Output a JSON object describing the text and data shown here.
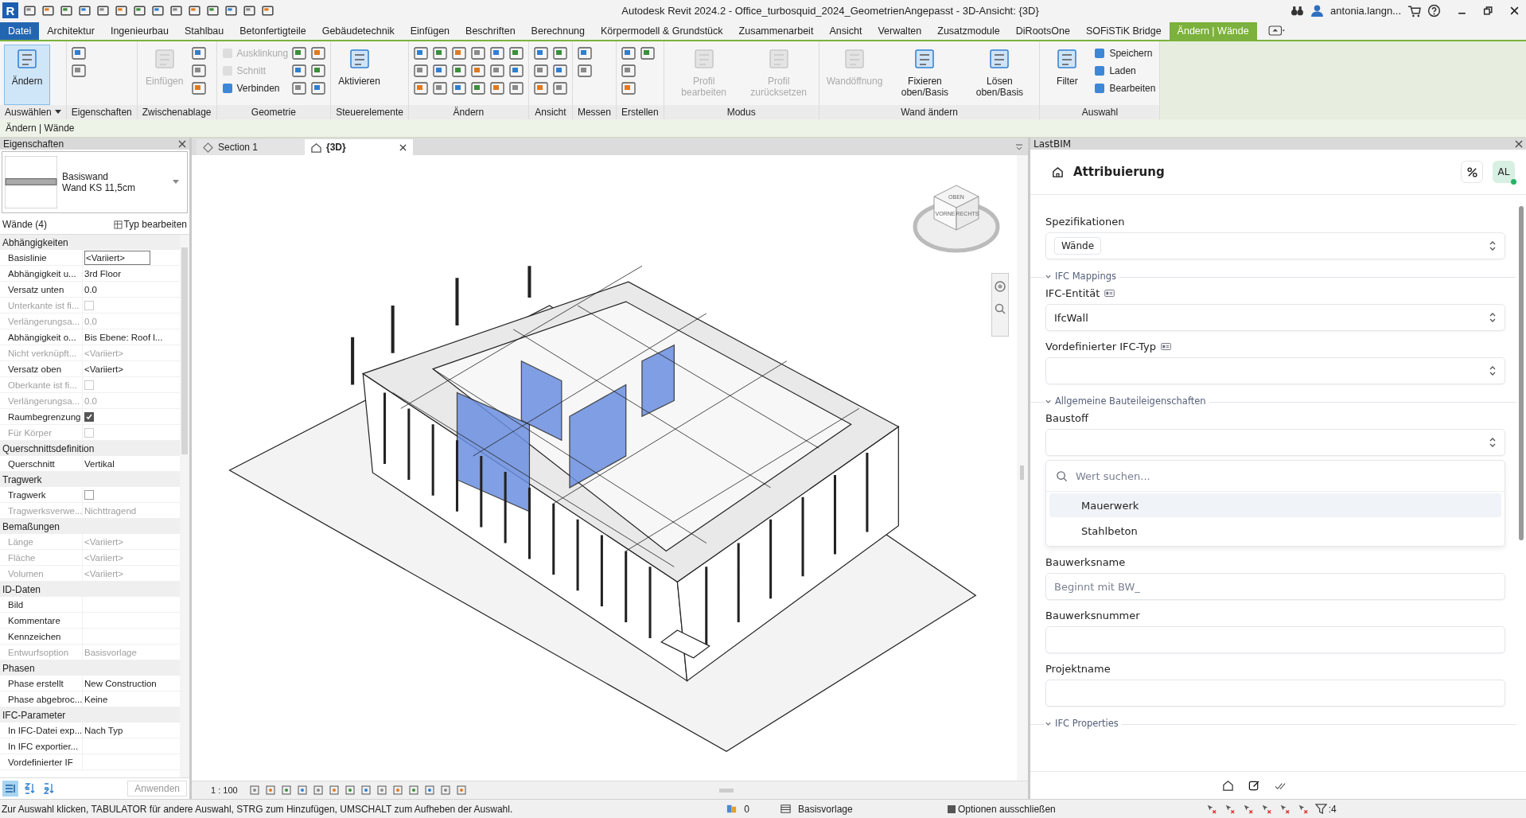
{
  "title_bar": {
    "logo": "R",
    "title": "Autodesk Revit 2024.2 - Office_turbosquid_2024_GeometrienAngepasst - 3D-Ansicht: {3D}",
    "user": "antonia.langn..."
  },
  "ribbon_tabs": [
    {
      "label": "Datei",
      "kind": "file",
      "selected": false
    },
    {
      "label": "Architektur",
      "kind": "tab",
      "selected": false
    },
    {
      "label": "Ingenieurbau",
      "kind": "tab",
      "selected": false
    },
    {
      "label": "Stahlbau",
      "kind": "tab",
      "selected": false
    },
    {
      "label": "Betonfertigteile",
      "kind": "tab",
      "selected": false
    },
    {
      "label": "Gebäudetechnik",
      "kind": "tab",
      "selected": false
    },
    {
      "label": "Einfügen",
      "kind": "tab",
      "selected": false
    },
    {
      "label": "Beschriften",
      "kind": "tab",
      "selected": false
    },
    {
      "label": "Berechnung",
      "kind": "tab",
      "selected": false
    },
    {
      "label": "Körpermodell & Grundstück",
      "kind": "tab",
      "selected": false
    },
    {
      "label": "Zusammenarbeit",
      "kind": "tab",
      "selected": false
    },
    {
      "label": "Ansicht",
      "kind": "tab",
      "selected": false
    },
    {
      "label": "Verwalten",
      "kind": "tab",
      "selected": false
    },
    {
      "label": "Zusatzmodule",
      "kind": "tab",
      "selected": false
    },
    {
      "label": "DiRootsOne",
      "kind": "tab",
      "selected": false
    },
    {
      "label": "SOFiSTiK Bridge",
      "kind": "tab",
      "selected": false
    },
    {
      "label": "Ändern | Wände",
      "kind": "context",
      "selected": true
    }
  ],
  "ribbon_groups": [
    {
      "label": "Auswählen",
      "dropdown": true,
      "tools": [
        {
          "kind": "large",
          "label": "Ändern",
          "selected": true,
          "disabled": false
        }
      ]
    },
    {
      "label": "Eigenschaften",
      "tools": [
        {
          "kind": "icon"
        },
        {
          "kind": "icon"
        }
      ]
    },
    {
      "label": "Zwischenablage",
      "tools": [
        {
          "kind": "large",
          "label": "Einfügen",
          "disabled": true
        },
        {
          "kind": "icon"
        },
        {
          "kind": "icon"
        },
        {
          "kind": "icon"
        }
      ]
    },
    {
      "label": "Geometrie",
      "tools": [
        {
          "kind": "small",
          "label": "Ausklinkung",
          "disabled": true
        },
        {
          "kind": "small",
          "label": "Schnitt",
          "disabled": true
        },
        {
          "kind": "small",
          "label": "Verbinden",
          "disabled": false
        },
        {
          "kind": "icon"
        },
        {
          "kind": "icon"
        },
        {
          "kind": "icon"
        },
        {
          "kind": "icon"
        },
        {
          "kind": "icon"
        },
        {
          "kind": "icon"
        }
      ]
    },
    {
      "label": "Steuerelemente",
      "tools": [
        {
          "kind": "large",
          "label": "Aktivieren",
          "disabled": false
        }
      ]
    },
    {
      "label": "Ändern",
      "tools": [
        {
          "kind": "icon"
        },
        {
          "kind": "icon"
        },
        {
          "kind": "icon"
        },
        {
          "kind": "icon"
        },
        {
          "kind": "icon"
        },
        {
          "kind": "icon"
        },
        {
          "kind": "icon"
        },
        {
          "kind": "icon"
        },
        {
          "kind": "icon"
        },
        {
          "kind": "icon"
        },
        {
          "kind": "icon"
        },
        {
          "kind": "icon"
        },
        {
          "kind": "icon"
        },
        {
          "kind": "icon"
        },
        {
          "kind": "icon"
        },
        {
          "kind": "icon"
        },
        {
          "kind": "icon"
        },
        {
          "kind": "icon"
        }
      ]
    },
    {
      "label": "Ansicht",
      "tools": [
        {
          "kind": "icon"
        },
        {
          "kind": "icon"
        },
        {
          "kind": "icon"
        },
        {
          "kind": "icon"
        },
        {
          "kind": "icon"
        },
        {
          "kind": "icon"
        }
      ]
    },
    {
      "label": "Messen",
      "tools": [
        {
          "kind": "icon"
        },
        {
          "kind": "icon"
        }
      ]
    },
    {
      "label": "Erstellen",
      "tools": [
        {
          "kind": "icon"
        },
        {
          "kind": "icon"
        },
        {
          "kind": "icon"
        },
        {
          "kind": "icon"
        }
      ]
    },
    {
      "label": "Modus",
      "tools": [
        {
          "kind": "large",
          "label": "Profil bearbeiten",
          "disabled": true
        },
        {
          "kind": "large",
          "label": "Profil zurücksetzen",
          "disabled": true
        }
      ]
    },
    {
      "label": "Wand ändern",
      "tools": [
        {
          "kind": "large",
          "label": "Wandöffnung",
          "disabled": true
        },
        {
          "kind": "large",
          "label": "Fixieren oben/Basis",
          "disabled": false
        },
        {
          "kind": "large",
          "label": "Lösen oben/Basis",
          "disabled": false
        }
      ]
    },
    {
      "label": "Auswahl",
      "tools": [
        {
          "kind": "large",
          "label": "Filter",
          "disabled": false
        },
        {
          "kind": "small",
          "label": "Speichern",
          "disabled": false
        },
        {
          "kind": "small",
          "label": "Laden",
          "disabled": false
        },
        {
          "kind": "small",
          "label": "Bearbeiten",
          "disabled": false
        }
      ]
    }
  ],
  "context_bar": "Ändern | Wände",
  "properties": {
    "title": "Eigenschaften",
    "family": "Basiswand",
    "type": "Wand KS 11,5cm",
    "filter": "Wände (4)",
    "edit_type": "Typ bearbeiten",
    "apply": "Anwenden",
    "rows": [
      {
        "kind": "group",
        "name": "Abhängigkeiten"
      },
      {
        "kind": "input",
        "name": "Basislinie",
        "value": "<Variiert>",
        "disabled": false
      },
      {
        "kind": "text",
        "name": "Abhängigkeit u...",
        "value": "3rd Floor",
        "disabled": false
      },
      {
        "kind": "text",
        "name": "Versatz unten",
        "value": "0.0",
        "disabled": false
      },
      {
        "kind": "checkbox",
        "name": "Unterkante ist fi...",
        "checked": false,
        "disabled": true
      },
      {
        "kind": "text",
        "name": "Verlängerungsa...",
        "value": "0.0",
        "disabled": true
      },
      {
        "kind": "text",
        "name": "Abhängigkeit o...",
        "value": "Bis Ebene: Roof l...",
        "disabled": false
      },
      {
        "kind": "text",
        "name": "Nicht verknüpft...",
        "value": "<Variiert>",
        "disabled": true
      },
      {
        "kind": "text",
        "name": "Versatz oben",
        "value": "<Variiert>",
        "disabled": false
      },
      {
        "kind": "checkbox",
        "name": "Oberkante ist fi...",
        "checked": false,
        "disabled": true
      },
      {
        "kind": "text",
        "name": "Verlängerungsa...",
        "value": "0.0",
        "disabled": true
      },
      {
        "kind": "checkbox",
        "name": "Raumbegrenzung",
        "checked": true,
        "disabled": false
      },
      {
        "kind": "checkbox",
        "name": "Für Körper",
        "checked": false,
        "disabled": true
      },
      {
        "kind": "group",
        "name": "Querschnittsdefinition"
      },
      {
        "kind": "text",
        "name": "Querschnitt",
        "value": "Vertikal",
        "disabled": false
      },
      {
        "kind": "group",
        "name": "Tragwerk"
      },
      {
        "kind": "checkbox",
        "name": "Tragwerk",
        "checked": false,
        "disabled": false
      },
      {
        "kind": "text",
        "name": "Tragwerksverwe...",
        "value": "Nichttragend",
        "disabled": true
      },
      {
        "kind": "group",
        "name": "Bemaßungen"
      },
      {
        "kind": "text",
        "name": "Länge",
        "value": "<Variiert>",
        "disabled": true
      },
      {
        "kind": "text",
        "name": "Fläche",
        "value": "<Variiert>",
        "disabled": true
      },
      {
        "kind": "text",
        "name": "Volumen",
        "value": "<Variiert>",
        "disabled": true
      },
      {
        "kind": "group",
        "name": "ID-Daten"
      },
      {
        "kind": "text",
        "name": "Bild",
        "disabled": false
      },
      {
        "kind": "text",
        "name": "Kommentare",
        "disabled": false
      },
      {
        "kind": "text",
        "name": "Kennzeichen",
        "disabled": false
      },
      {
        "kind": "text",
        "name": "Entwurfsoption",
        "value": "Basisvorlage",
        "disabled": true
      },
      {
        "kind": "group",
        "name": "Phasen"
      },
      {
        "kind": "text",
        "name": "Phase erstellt",
        "value": "New Construction",
        "disabled": false
      },
      {
        "kind": "text",
        "name": "Phase abgebroc...",
        "value": "Keine",
        "disabled": false
      },
      {
        "kind": "group",
        "name": "IFC-Parameter"
      },
      {
        "kind": "text",
        "name": "In IFC-Datei exp...",
        "value": "Nach Typ",
        "disabled": false
      },
      {
        "kind": "text",
        "name": "In IFC exportier...",
        "disabled": false
      },
      {
        "kind": "text",
        "name": "Vordefinierter IF",
        "disabled": false
      }
    ]
  },
  "view_tabs": [
    {
      "label": "Section 1",
      "kind": "section",
      "selected": false
    },
    {
      "label": "{3D}",
      "kind": "model",
      "selected": true
    }
  ],
  "view_cube": {
    "top": "OBEN",
    "front": "VORNE",
    "right": "RECHTS"
  },
  "view_bar": {
    "scale": "1 : 100"
  },
  "lastbim": {
    "title": "LastBIM",
    "heading": "Attribuierung",
    "avatar": "AL",
    "online": true,
    "items": [
      {
        "kind": "select",
        "label": "Spezifikationen",
        "chip": "Wände"
      },
      {
        "kind": "section",
        "label": "IFC Mappings",
        "expanded": true
      },
      {
        "kind": "select",
        "label": "IFC-Entität",
        "info": true,
        "value": "IfcWall"
      },
      {
        "kind": "select",
        "label": "Vordefinierter IFC-Typ",
        "info": true
      },
      {
        "kind": "section",
        "label": "Allgemeine Bauteileigenschaften",
        "expanded": true
      },
      {
        "kind": "select",
        "label": "Baustoff"
      },
      {
        "kind": "dropdown",
        "placeholder": "Wert suchen...",
        "options": [
          {
            "label": "Mauerwerk",
            "highlighted": true
          },
          {
            "label": "Stahlbeton",
            "highlighted": false
          }
        ]
      },
      {
        "kind": "input",
        "label": "Bauwerksname",
        "placeholder": "Beginnt mit BW_"
      },
      {
        "kind": "input",
        "label": "Bauwerksnummer"
      },
      {
        "kind": "input",
        "label": "Projektname"
      },
      {
        "kind": "section",
        "label": "IFC Properties",
        "expanded": true
      }
    ]
  },
  "status_bar": {
    "hint": "Zur Auswahl klicken, TABULATOR für andere Auswahl, STRG zum Hinzufügen, UMSCHALT zum Aufheben der Auswahl.",
    "worksets": "0",
    "design_option": "Basisvorlage",
    "exclude_options": {
      "label": "Optionen ausschließen",
      "checked": true
    },
    "filter_count": ":4"
  }
}
